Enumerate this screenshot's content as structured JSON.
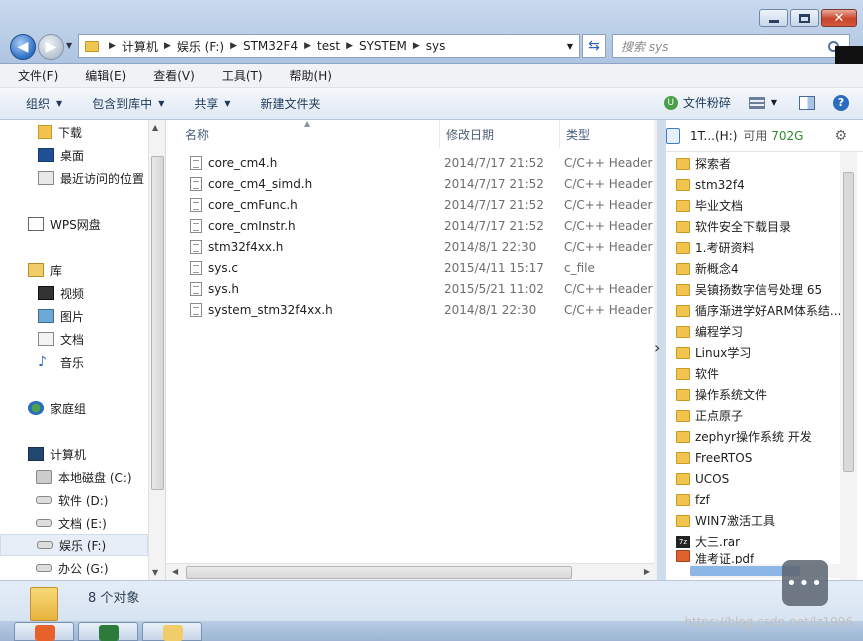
{
  "address": {
    "crumbs": [
      "计算机",
      "娱乐 (F:)",
      "STM32F4",
      "test",
      "SYSTEM",
      "sys"
    ]
  },
  "search": {
    "placeholder": "搜索 sys"
  },
  "menu": [
    "文件(F)",
    "编辑(E)",
    "查看(V)",
    "工具(T)",
    "帮助(H)"
  ],
  "toolbar": {
    "organize": "组织",
    "include_library": "包含到库中",
    "share": "共享",
    "new_folder": "新建文件夹",
    "shred": "文件粉碎"
  },
  "nav": {
    "items": [
      {
        "label": "下载",
        "icon": "folder-download-icon"
      },
      {
        "label": "桌面",
        "icon": "desktop-icon"
      },
      {
        "label": "最近访问的位置",
        "icon": "recent-places-icon"
      },
      {
        "label": "WPS网盘",
        "icon": "wps-cloud-icon"
      },
      {
        "label": "库",
        "icon": "library-icon"
      },
      {
        "label": "视频",
        "icon": "video-library-icon"
      },
      {
        "label": "图片",
        "icon": "picture-library-icon"
      },
      {
        "label": "文档",
        "icon": "document-library-icon"
      },
      {
        "label": "音乐",
        "icon": "music-library-icon"
      },
      {
        "label": "家庭组",
        "icon": "homegroup-icon"
      },
      {
        "label": "计算机",
        "icon": "computer-icon"
      },
      {
        "label": "本地磁盘 (C:)",
        "icon": "windows-drive-icon"
      },
      {
        "label": "软件 (D:)",
        "icon": "drive-icon"
      },
      {
        "label": "文档 (E:)",
        "icon": "drive-icon"
      },
      {
        "label": "娱乐 (F:)",
        "icon": "drive-icon"
      },
      {
        "label": "办公 (G:)",
        "icon": "drive-icon"
      }
    ]
  },
  "columns": {
    "name": "名称",
    "date": "修改日期",
    "type": "类型"
  },
  "files": [
    {
      "name": "core_cm4.h",
      "date": "2014/7/17 21:52",
      "type": "C/C++ Header"
    },
    {
      "name": "core_cm4_simd.h",
      "date": "2014/7/17 21:52",
      "type": "C/C++ Header"
    },
    {
      "name": "core_cmFunc.h",
      "date": "2014/7/17 21:52",
      "type": "C/C++ Header"
    },
    {
      "name": "core_cmInstr.h",
      "date": "2014/7/17 21:52",
      "type": "C/C++ Header"
    },
    {
      "name": "stm32f4xx.h",
      "date": "2014/8/1 22:30",
      "type": "C/C++ Header"
    },
    {
      "name": "sys.c",
      "date": "2015/4/11 15:17",
      "type": "c_file"
    },
    {
      "name": "sys.h",
      "date": "2015/5/21 11:02",
      "type": "C/C++ Header"
    },
    {
      "name": "system_stm32f4xx.h",
      "date": "2014/8/1 22:30",
      "type": "C/C++ Header"
    }
  ],
  "right_panel": {
    "drive": "1T...(H:)",
    "free_label": "可用",
    "free_value": "702G",
    "items": [
      {
        "label": "探索者",
        "kind": "folder"
      },
      {
        "label": "stm32f4",
        "kind": "folder"
      },
      {
        "label": "毕业文档",
        "kind": "folder"
      },
      {
        "label": "软件安全下载目录",
        "kind": "folder"
      },
      {
        "label": "1.考研资料",
        "kind": "folder"
      },
      {
        "label": "新概念4",
        "kind": "folder"
      },
      {
        "label": "吴镇扬数字信号处理 65",
        "kind": "folder"
      },
      {
        "label": "循序渐进学好ARM体系结...",
        "kind": "folder"
      },
      {
        "label": "编程学习",
        "kind": "folder"
      },
      {
        "label": "Linux学习",
        "kind": "folder"
      },
      {
        "label": "软件",
        "kind": "folder"
      },
      {
        "label": "操作系统文件",
        "kind": "folder"
      },
      {
        "label": "正点原子",
        "kind": "folder"
      },
      {
        "label": "zephyr操作系统 开发",
        "kind": "folder"
      },
      {
        "label": "FreeRTOS",
        "kind": "folder"
      },
      {
        "label": "UCOS",
        "kind": "folder"
      },
      {
        "label": "fzf",
        "kind": "folder"
      },
      {
        "label": "WIN7激活工具",
        "kind": "folder"
      },
      {
        "label": "大三.rar",
        "kind": "rar"
      },
      {
        "label": "准考证.pdf",
        "kind": "pdf"
      }
    ]
  },
  "status": {
    "count": "8 个对象"
  },
  "watermark": "https://blog.csdn.net/lz1996"
}
